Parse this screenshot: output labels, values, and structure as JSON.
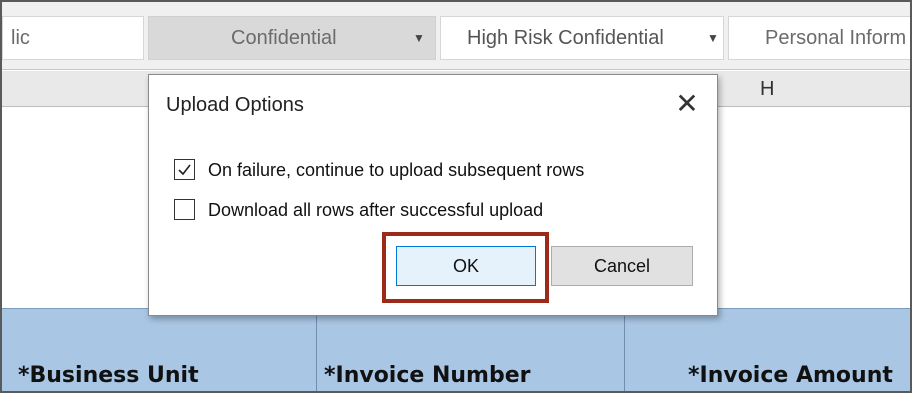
{
  "label_bar": {
    "chips": [
      {
        "label": "lic",
        "selected": false
      },
      {
        "label": "Confidential",
        "selected": true
      },
      {
        "label": "High Risk Confidential",
        "selected": false
      },
      {
        "label": "Personal Inform",
        "selected": false
      }
    ]
  },
  "sheet": {
    "column_letter": "H",
    "headers": [
      "*Business Unit",
      "*Invoice Number",
      "*Invoice Amount"
    ],
    "header_fill": "#a9c6e4"
  },
  "dialog": {
    "title": "Upload Options",
    "options": [
      {
        "label": "On failure, continue to upload subsequent rows",
        "checked": true
      },
      {
        "label": "Download all rows after successful upload",
        "checked": false
      }
    ],
    "ok_label": "OK",
    "cancel_label": "Cancel",
    "highlight_color": "#9b2a1b"
  }
}
